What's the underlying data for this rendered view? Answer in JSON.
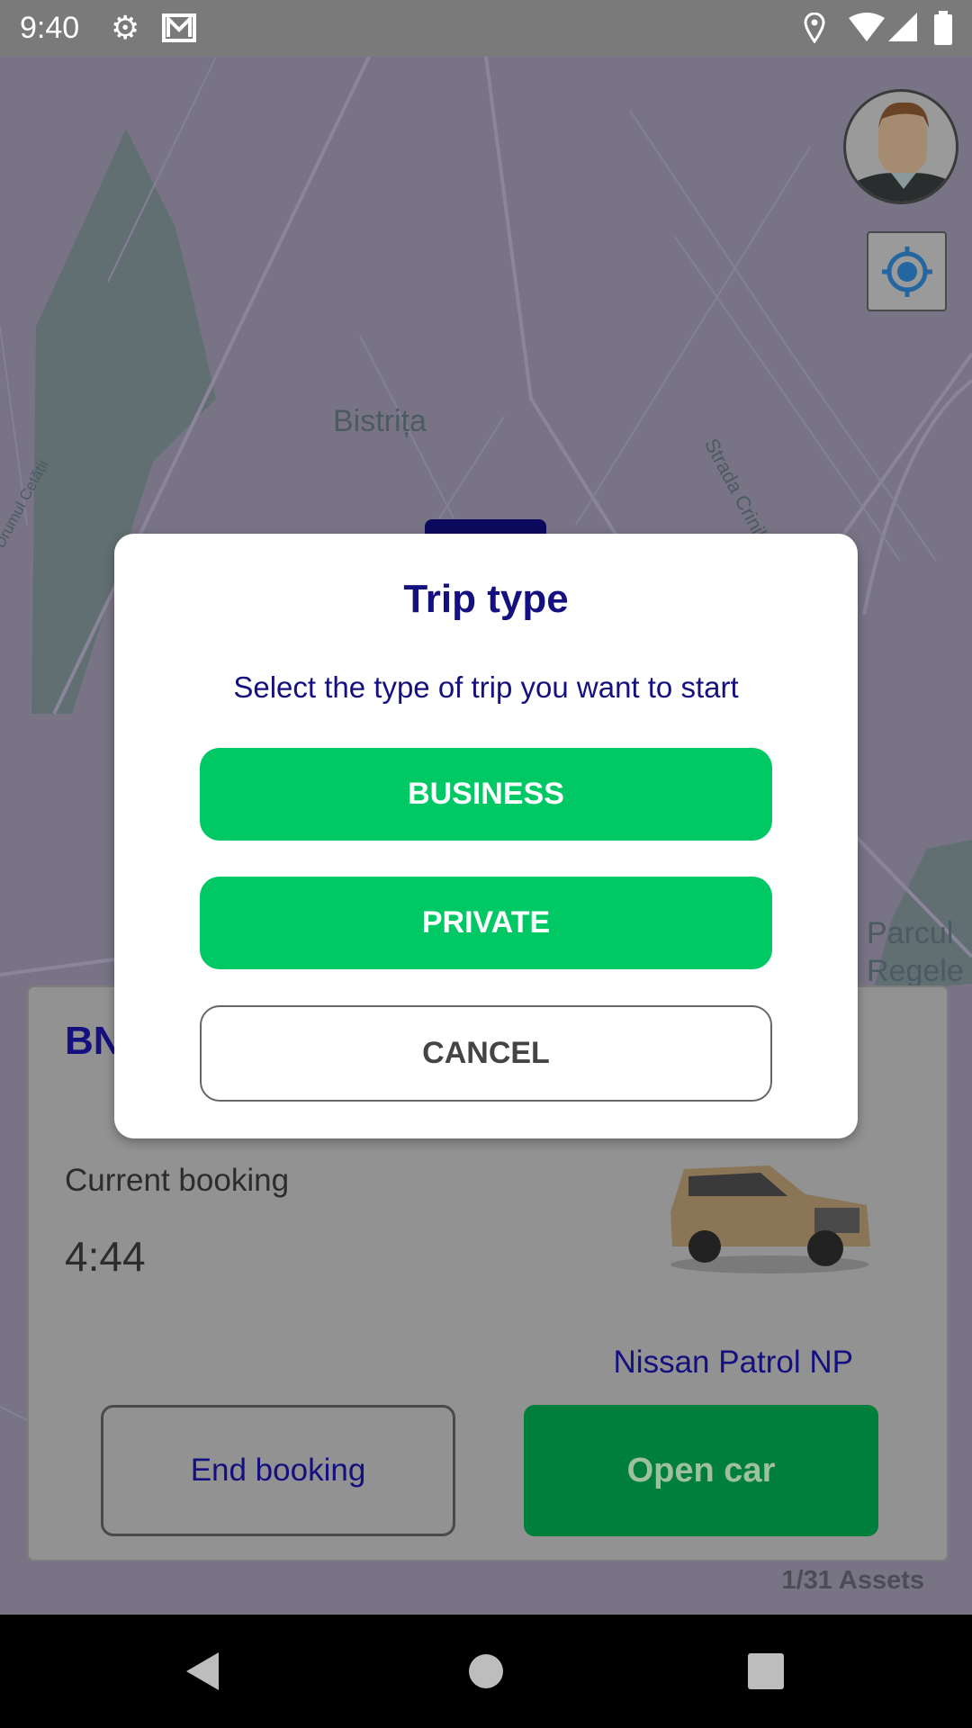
{
  "status_bar": {
    "time": "9:40",
    "left_icons": [
      "gear-icon",
      "mail-icon"
    ],
    "right_icons": [
      "location-icon",
      "wifi-icon",
      "signal-icon",
      "battery-icon"
    ]
  },
  "map": {
    "labels": [
      "Bistrița",
      "Drumul Cetății",
      "Strada Crinilor",
      "Parcul",
      "Regele"
    ]
  },
  "colors": {
    "navy": "#14107f",
    "green": "#00c864",
    "dark_green": "#007f3c",
    "dim_map": "#787486"
  },
  "card": {
    "plate": "BN",
    "current_booking": "Current booking",
    "timer": "4:44",
    "car_name": "Nissan Patrol NP",
    "end_booking": "End booking",
    "open_car": "Open car"
  },
  "assets_count": "1/31 Assets",
  "dialog": {
    "title": "Trip type",
    "subtitle": "Select the type of trip you want to start",
    "business": "BUSINESS",
    "private": "PRIVATE",
    "cancel": "CANCEL"
  }
}
